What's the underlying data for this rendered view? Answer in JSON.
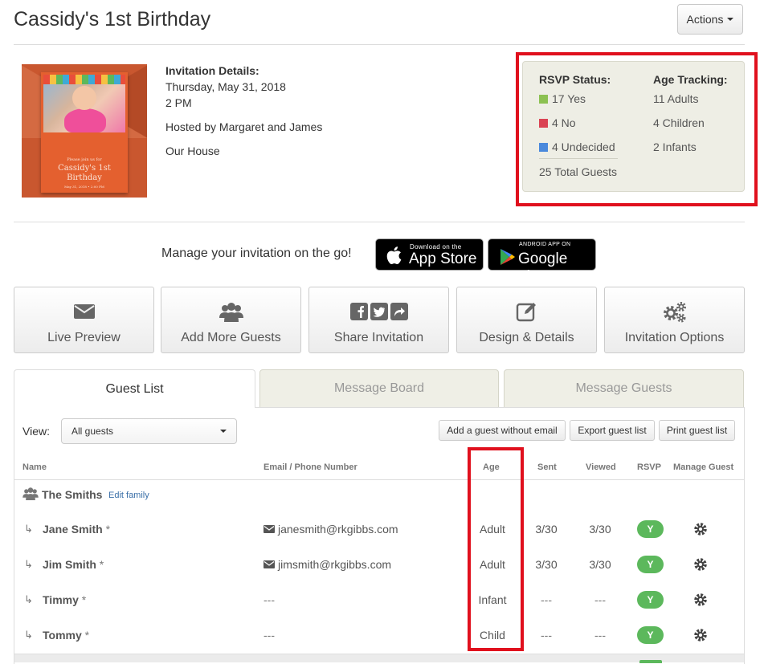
{
  "header": {
    "title": "Cassidy's 1st Birthday",
    "actions_label": "Actions"
  },
  "card": {
    "top_text": "Please join us for",
    "name": "Cassidy's 1st Birthday",
    "date": "May 31, 2018 • 2:00 PM"
  },
  "details": {
    "heading": "Invitation Details:",
    "date": "Thursday, May 31, 2018",
    "time": "2 PM",
    "hosted": "Hosted by Margaret and James",
    "location": "Our House"
  },
  "rsvp": {
    "heading": "RSVP Status:",
    "yes": "17 Yes",
    "no": "4 No",
    "undecided": "4 Undecided",
    "total": "25 Total Guests",
    "colors": {
      "yes": "#8cc152",
      "no": "#da4453",
      "undecided": "#4a89dc"
    }
  },
  "age_tracking": {
    "heading": "Age Tracking:",
    "adults": "11 Adults",
    "children": "4 Children",
    "infants": "2 Infants"
  },
  "app_promo": {
    "text": "Manage your invitation on the go!",
    "appstore_small": "Download on the",
    "appstore_big": "App Store",
    "google_small": "ANDROID APP ON",
    "google_big": "Google play"
  },
  "tiles": [
    {
      "label": "Live Preview",
      "icon": "envelope-icon"
    },
    {
      "label": "Add More Guests",
      "icon": "users-icon"
    },
    {
      "label": "Share Invitation",
      "icon": "social-share-icon"
    },
    {
      "label": "Design & Details",
      "icon": "edit-icon"
    },
    {
      "label": "Invitation Options",
      "icon": "gears-icon"
    }
  ],
  "tabs": [
    {
      "label": "Guest List",
      "active": true
    },
    {
      "label": "Message Board",
      "active": false
    },
    {
      "label": "Message Guests",
      "active": false
    }
  ],
  "toolbar": {
    "view_label": "View:",
    "view_value": "All guests",
    "add_btn": "Add a guest without email",
    "export_btn": "Export guest list",
    "print_btn": "Print guest list"
  },
  "table": {
    "headers": {
      "name": "Name",
      "contact": "Email / Phone Number",
      "age": "Age",
      "sent": "Sent",
      "viewed": "Viewed",
      "rsvp": "RSVP",
      "manage": "Manage Guest"
    },
    "family": {
      "name": "The Smiths",
      "edit": "Edit family"
    },
    "rows": [
      {
        "name": "Jane Smith",
        "star": "*",
        "contact": "janesmith@rkgibbs.com",
        "age": "Adult",
        "sent": "3/30",
        "viewed": "3/30",
        "rsvp": "Y"
      },
      {
        "name": "Jim Smith",
        "star": "*",
        "contact": "jimsmith@rkgibbs.com",
        "age": "Adult",
        "sent": "3/30",
        "viewed": "3/30",
        "rsvp": "Y"
      },
      {
        "name": "Timmy",
        "star": "*",
        "contact": "---",
        "age": "Infant",
        "sent": "---",
        "viewed": "---",
        "rsvp": "Y"
      },
      {
        "name": "Tommy",
        "star": "*",
        "contact": "---",
        "age": "Child",
        "sent": "---",
        "viewed": "---",
        "rsvp": "Y"
      }
    ]
  }
}
